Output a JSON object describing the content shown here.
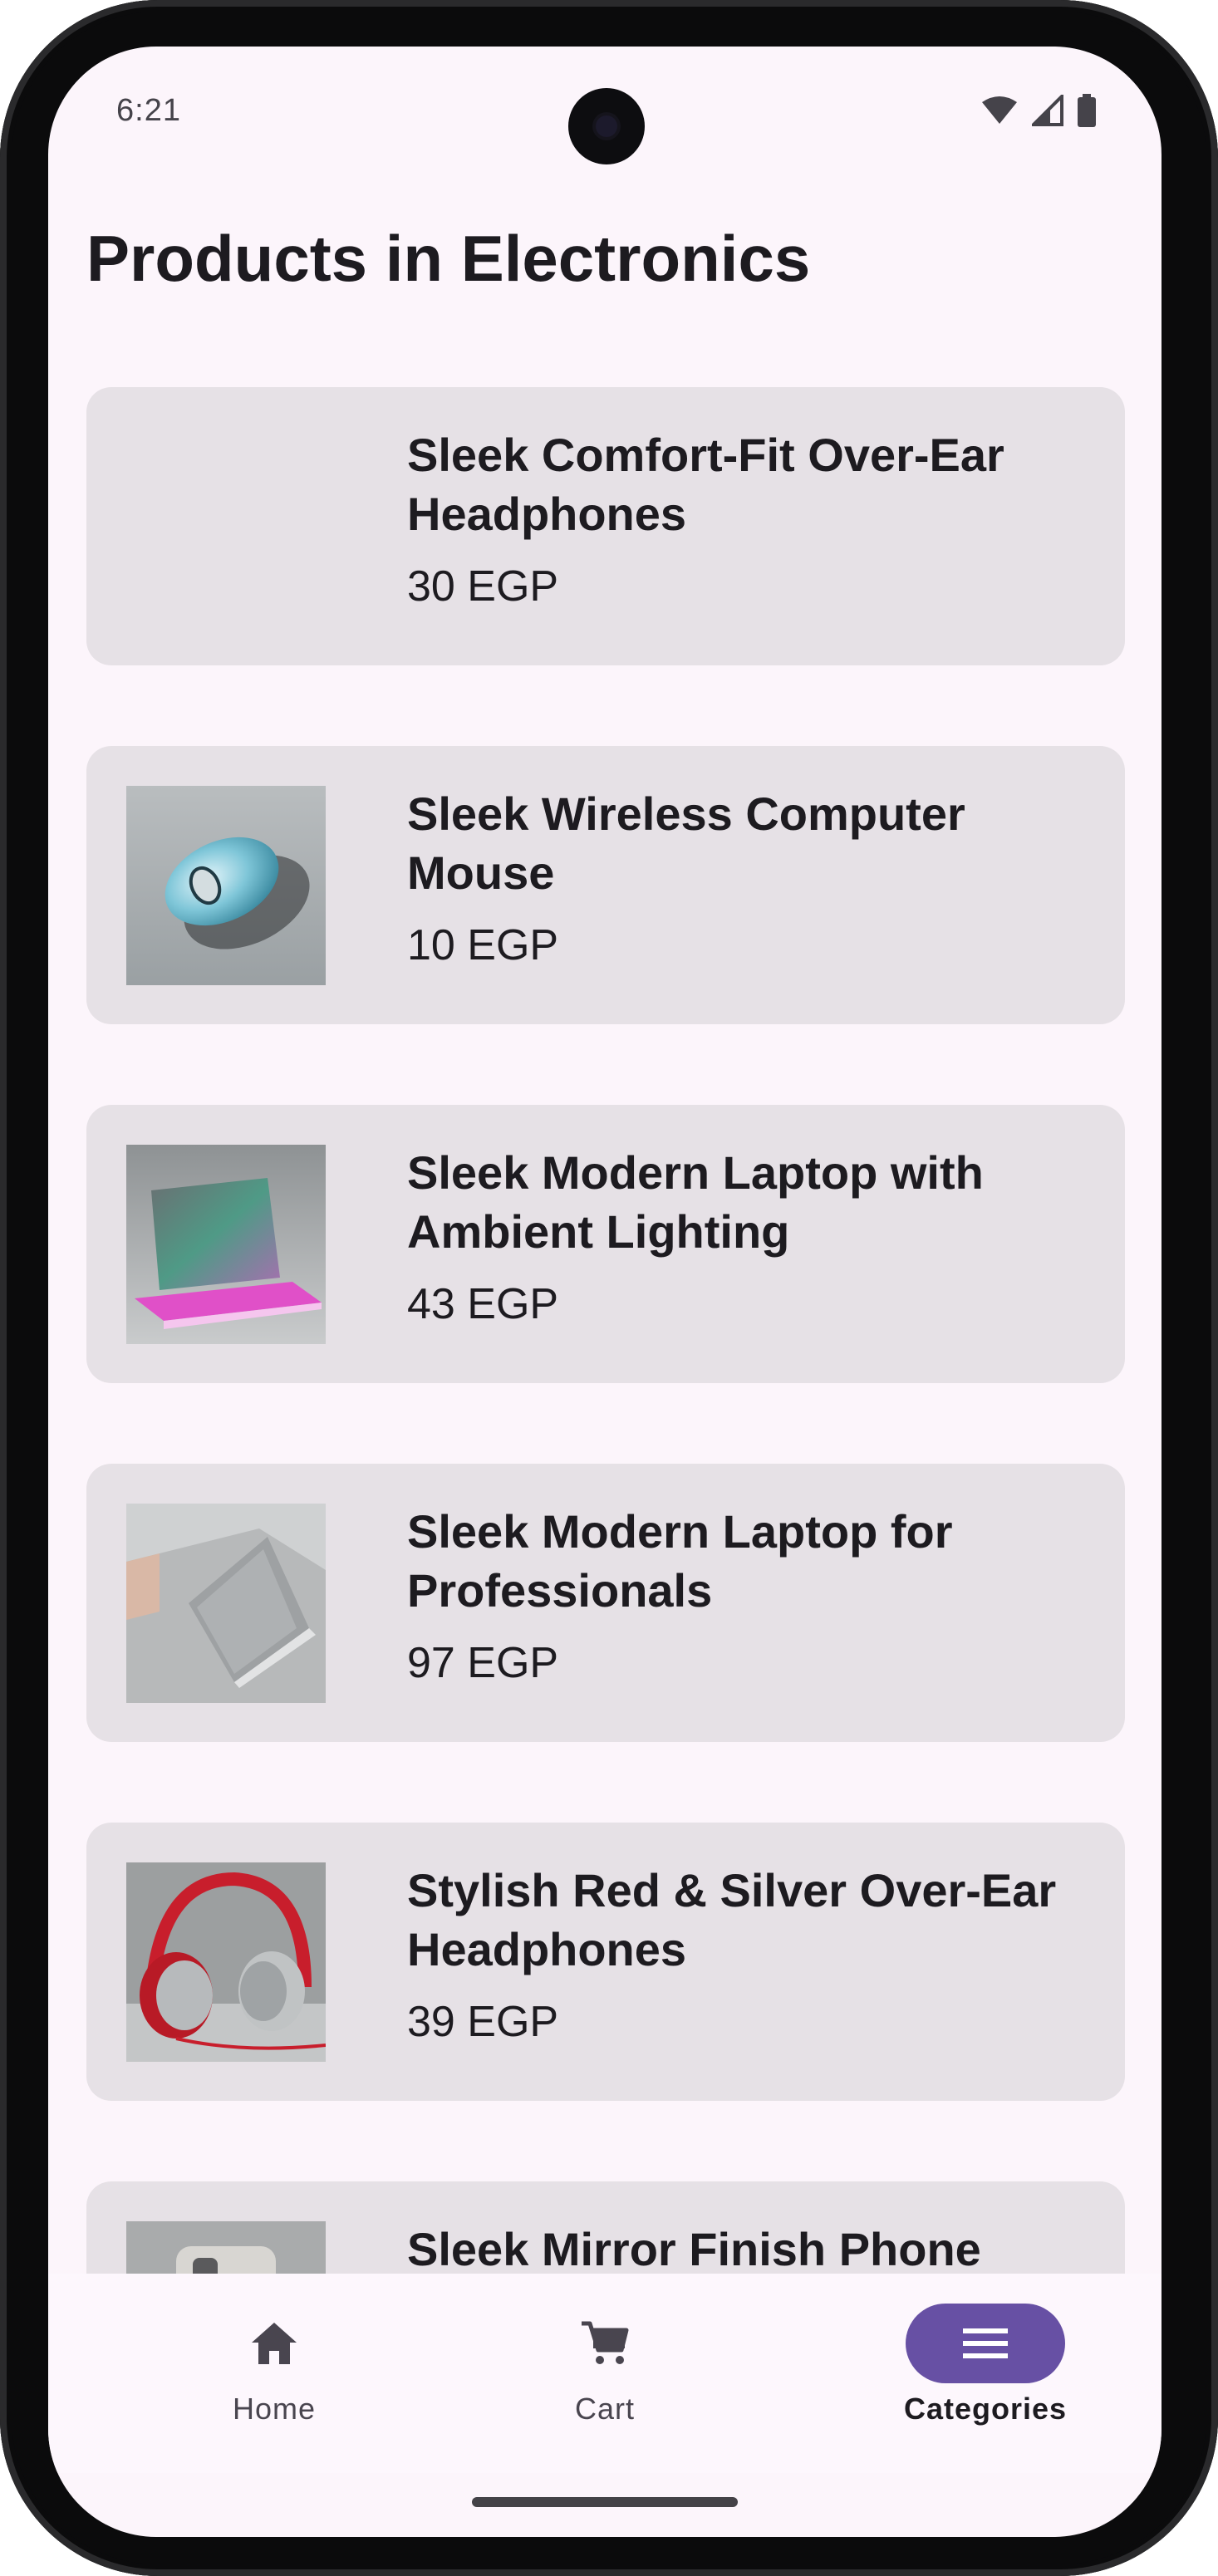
{
  "status_bar": {
    "time": "6:21"
  },
  "page": {
    "title": "Products in Electronics"
  },
  "products": [
    {
      "name": "Sleek Comfort-Fit Over-Ear Headphones",
      "price": "30 EGP",
      "image": "none"
    },
    {
      "name": "Sleek Wireless Computer Mouse",
      "price": "10 EGP",
      "image": "mouse-photo"
    },
    {
      "name": "Sleek Modern Laptop with Ambient Lighting",
      "price": "43 EGP",
      "image": "laptop-ambient-photo"
    },
    {
      "name": "Sleek Modern Laptop for Professionals",
      "price": "97 EGP",
      "image": "laptop-professional-photo"
    },
    {
      "name": "Stylish Red & Silver Over-Ear Headphones",
      "price": "39 EGP",
      "image": "red-headphones-photo"
    },
    {
      "name": "Sleek Mirror Finish Phone",
      "price": "",
      "image": "phone-photo"
    }
  ],
  "bottom_nav": {
    "items": [
      {
        "label": "Home",
        "icon": "home-icon",
        "active": false
      },
      {
        "label": "Cart",
        "icon": "cart-icon",
        "active": false
      },
      {
        "label": "Categories",
        "icon": "menu-icon",
        "active": true
      }
    ]
  },
  "colors": {
    "background": "#fcf5fb",
    "card": "#e6e1e6",
    "accent": "#6750a4",
    "text": "#1d1b20"
  }
}
